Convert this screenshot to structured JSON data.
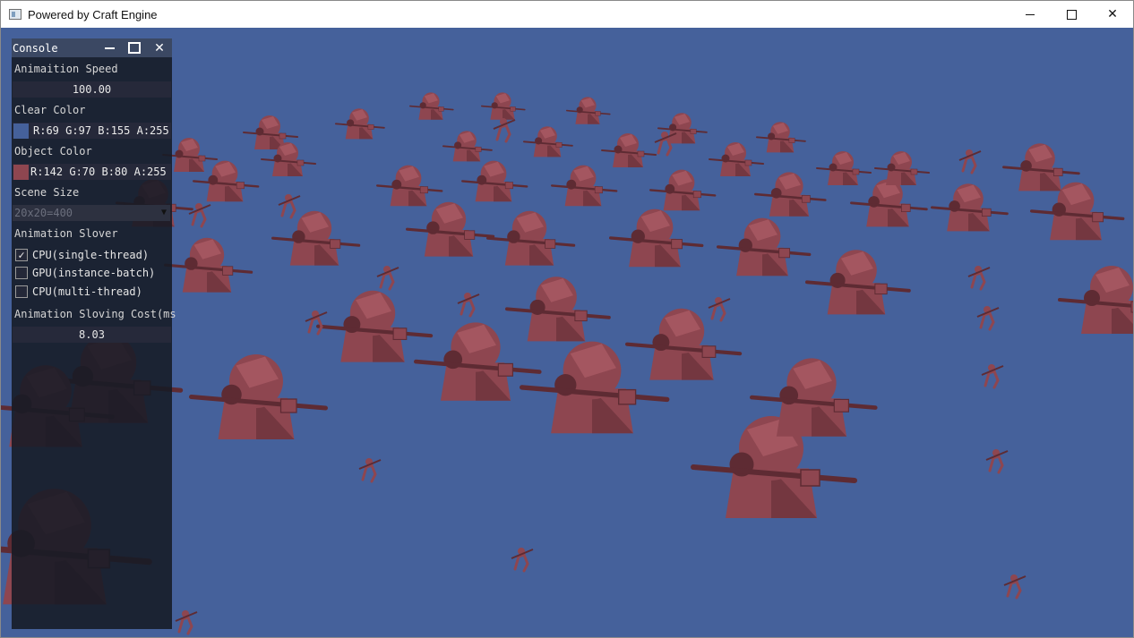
{
  "window": {
    "title": "Powered by Craft Engine",
    "close_glyph": "✕"
  },
  "console": {
    "title": "Console",
    "close_glyph": "✕",
    "animation_speed": {
      "label": "Animaition Speed",
      "value": "100.00"
    },
    "clear_color": {
      "label": "Clear Color",
      "text": "R:69  G:97 B:155 A:255",
      "swatch": "#45619b"
    },
    "object_color": {
      "label": "Object Color",
      "text": "R:142 G:70  B:80 A:255",
      "swatch": "#8e4650"
    },
    "scene_size": {
      "label": "Scene Size",
      "value": "20x20=400",
      "arrow": "▼"
    },
    "animation_solver": {
      "label": "Animation Slover",
      "options": [
        {
          "label": "CPU(single-thread)",
          "checked": true,
          "mark": "✓"
        },
        {
          "label": "GPU(instance-batch)",
          "checked": false,
          "mark": ""
        },
        {
          "label": "CPU(multi-thread)",
          "checked": false,
          "mark": ""
        }
      ]
    },
    "cost": {
      "label": "Animation Sloving Cost(ms",
      "value": "8.03"
    }
  },
  "scene": {
    "background": "#45619b",
    "object_color": "#8e4650",
    "object_dark": "#5e2b33",
    "object_light": "#b9656f"
  }
}
